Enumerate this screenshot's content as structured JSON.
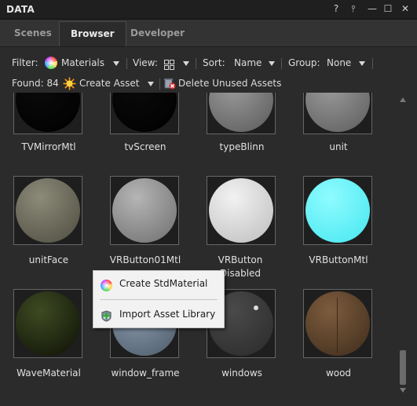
{
  "window": {
    "title": "DATA",
    "help_glyph": "?",
    "pin_glyph": "⫯",
    "min_glyph": "—",
    "max_glyph": "☐",
    "close_glyph": "✕"
  },
  "tabs": [
    {
      "label": "Scenes",
      "active": false
    },
    {
      "label": "Browser",
      "active": true
    },
    {
      "label": "Developer",
      "active": false
    }
  ],
  "toolbar": {
    "filter_label": "Filter:",
    "filter_value": "Materials",
    "view_label": "View:",
    "sort_label": "Sort:",
    "sort_value": "Name",
    "group_label": "Group:",
    "group_value": "None",
    "found_label": "Found: 84",
    "create_asset_label": "Create Asset",
    "delete_unused_label": "Delete Unused Assets"
  },
  "assets": [
    {
      "name": "TVMirrorMtl",
      "color_center": "#0a0a0a",
      "color_edge": "#000000"
    },
    {
      "name": "tvScreen",
      "color_center": "#0a0a0a",
      "color_edge": "#000000"
    },
    {
      "name": "typeBlinn",
      "color_center": "#9a9a9a",
      "color_edge": "#5a5a5a"
    },
    {
      "name": "unit",
      "color_center": "#9a9a9a",
      "color_edge": "#5c5c5c"
    },
    {
      "name": "unitFace",
      "color_center": "#8c8a78",
      "color_edge": "#4e4c40"
    },
    {
      "name": "VRButton01Mtl",
      "color_center": "#b5b5b5",
      "color_edge": "#6e6e6e"
    },
    {
      "name": "VRButton Disabled",
      "color_center": "#f2f2f2",
      "color_edge": "#bdbdbd"
    },
    {
      "name": "VRButtonMtl",
      "color_center": "#8ffcff",
      "color_edge": "#45e6f0"
    },
    {
      "name": "WaveMaterial",
      "color_center": "#3e4a22",
      "color_edge": "#0d1006"
    },
    {
      "name": "window_frame",
      "color_center": "#8ea0b3",
      "color_edge": "#4b5866"
    },
    {
      "name": "windows",
      "color_center": "#4a4a4a",
      "color_edge": "#2a2a2a"
    },
    {
      "name": "wood",
      "color_center": "#7d5c3d",
      "color_edge": "#3e2c1c"
    }
  ],
  "context_menu": {
    "items": [
      {
        "label": "Create StdMaterial",
        "icon": "color-wheel-icon"
      },
      {
        "label": "Import Asset Library",
        "icon": "import-library-icon"
      }
    ]
  },
  "colors": {
    "background": "#2b2b2b",
    "titlebar": "#1f1f1f",
    "menu_bg": "#f2f2f2",
    "scrollbar_thumb": "#6b6b6b"
  }
}
